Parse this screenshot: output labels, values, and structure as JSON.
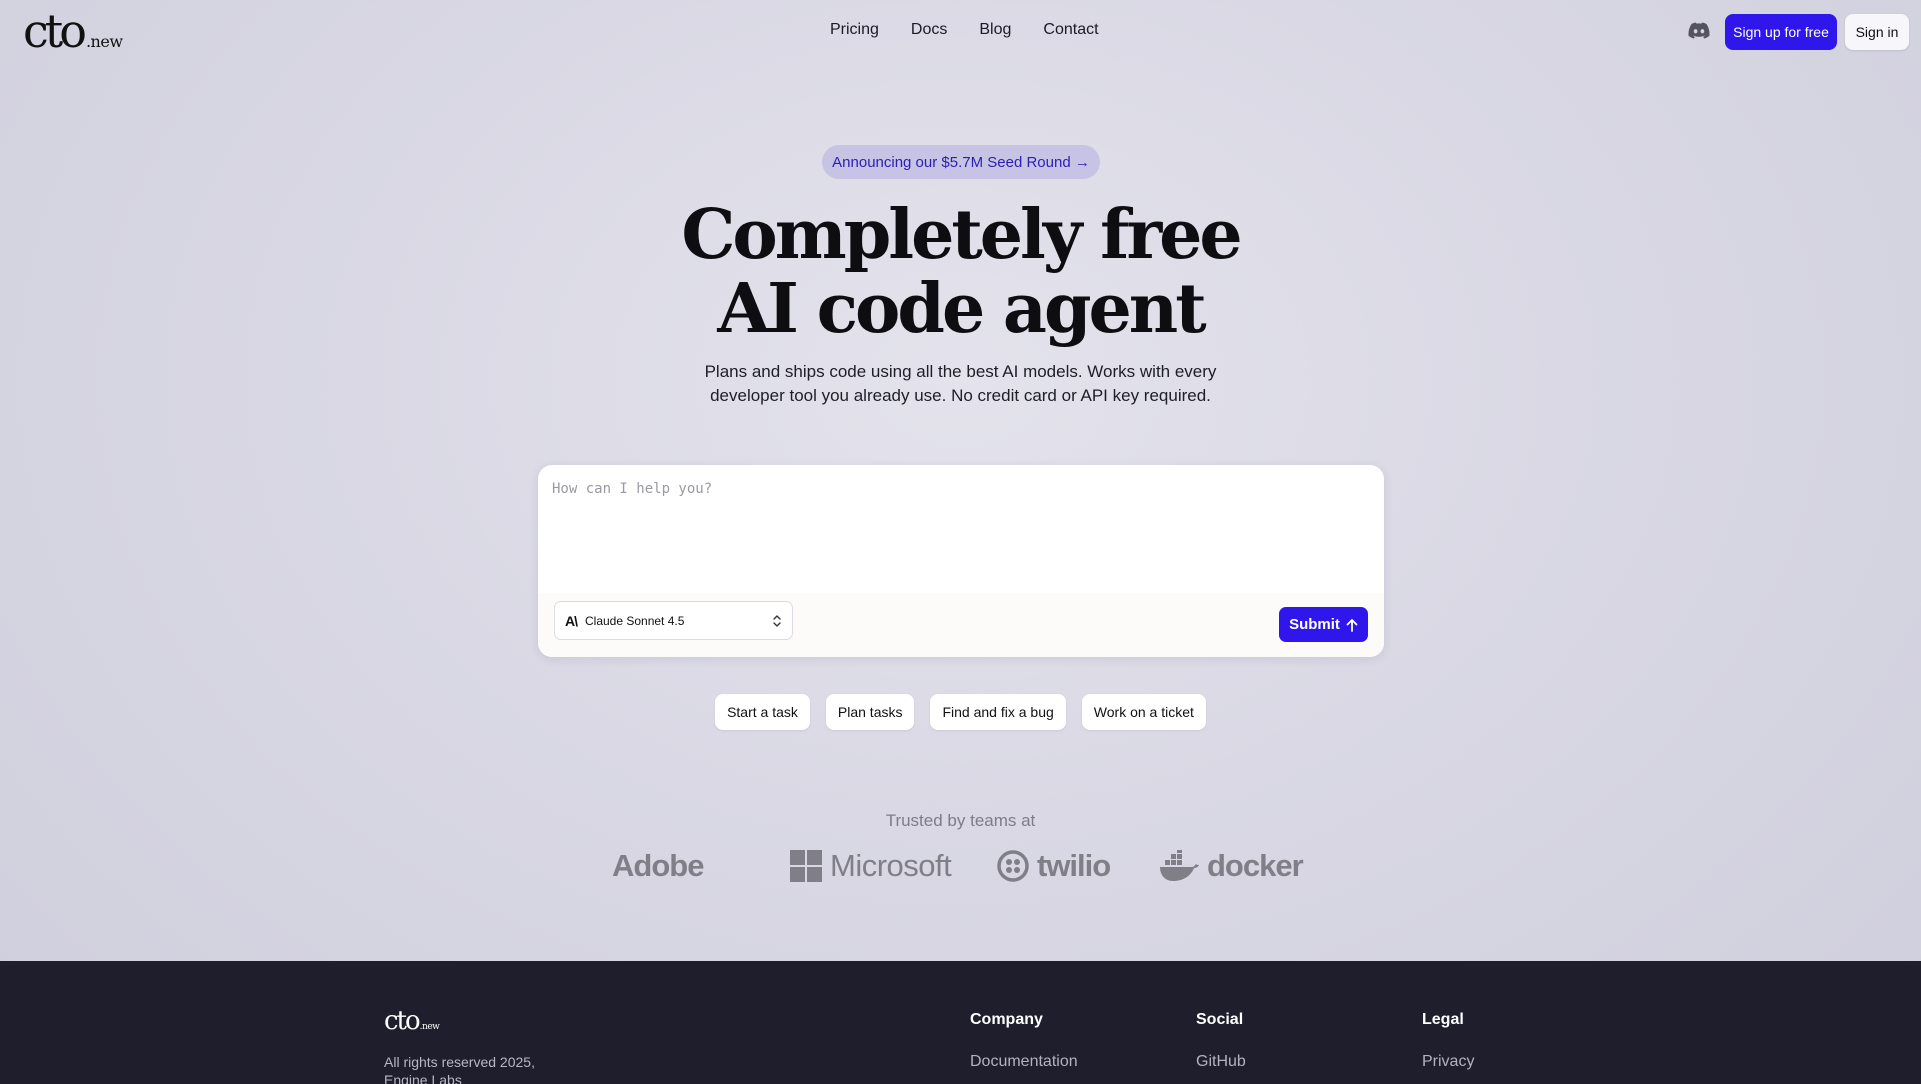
{
  "header": {
    "logo_main": "cto",
    "logo_sub": ".new",
    "nav": [
      "Pricing",
      "Docs",
      "Blog",
      "Contact"
    ],
    "discord_icon": "discord-icon",
    "signup_label": "Sign up for free",
    "signin_label": "Sign in"
  },
  "hero": {
    "announcement": "Announcing our $5.7M Seed Round →",
    "headline_line1": "Completely free",
    "headline_line2": "AI code agent",
    "subtitle_line1": "Plans and ships code using all the best AI models. Works with every",
    "subtitle_line2": "developer tool you already use. No credit card or API key required."
  },
  "prompt": {
    "placeholder": "How can I help you?",
    "value": "",
    "model_icon": "anthropic-icon",
    "model": "Claude Sonnet 4.5",
    "submit_label": "Submit",
    "submit_icon": "arrow-up-icon"
  },
  "chips": [
    "Start a task",
    "Plan tasks",
    "Find and fix a bug",
    "Work on a ticket"
  ],
  "trusted": {
    "label": "Trusted by teams at",
    "brands": [
      "Adobe",
      "Microsoft",
      "twilio",
      "docker"
    ]
  },
  "footer": {
    "logo_main": "cto",
    "logo_sub": ".new",
    "rights_line1": "All rights reserved 2025,",
    "rights_line2": "Engine Labs",
    "columns": [
      {
        "title": "Company",
        "links": [
          "Documentation"
        ]
      },
      {
        "title": "Social",
        "links": [
          "GitHub"
        ]
      },
      {
        "title": "Legal",
        "links": [
          "Privacy"
        ]
      }
    ]
  },
  "colors": {
    "accent": "#2f16ea",
    "footer_bg": "#1f1e2d",
    "announce_bg": "#c6c3e4"
  }
}
